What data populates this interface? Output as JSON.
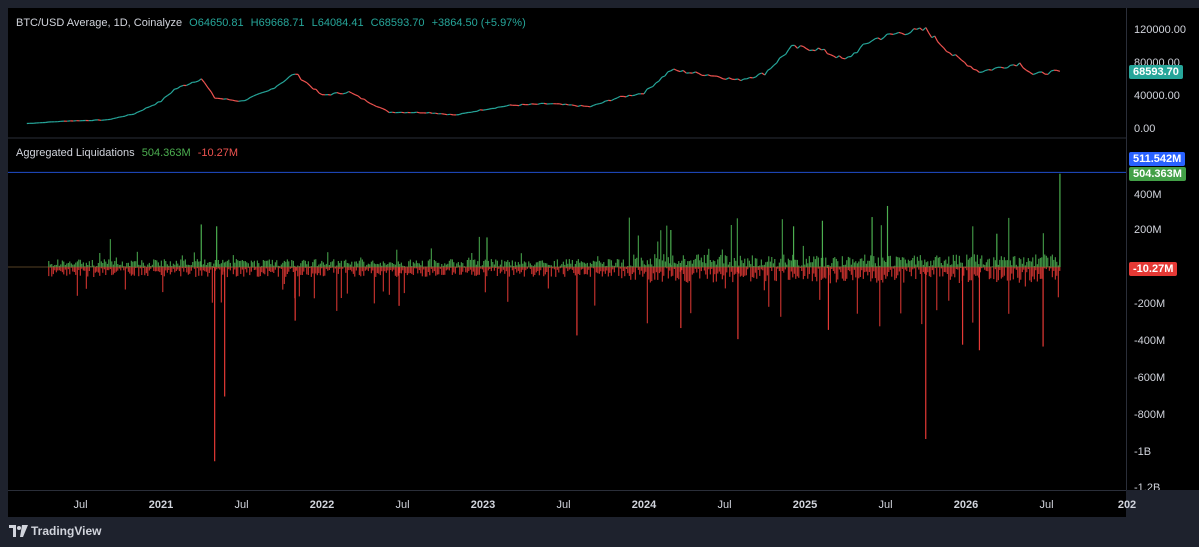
{
  "chart_data": [
    {
      "type": "candlestick-line",
      "title": "BTC/USD Average, 1D, Coinalyze",
      "ohlc": {
        "open_label": "O",
        "open": "64650.81",
        "high_label": "H",
        "high": "69668.71",
        "low_label": "L",
        "low": "64084.41",
        "close_label": "C",
        "close": "68593.70",
        "change": "+3864.50 (+5.97%)"
      },
      "y_ticks": [
        "120000.00",
        "80000.00",
        "40000.00",
        "0.00"
      ],
      "ylim": [
        0,
        130000
      ],
      "last_price_label": "68593.70",
      "x_start": "2020-03",
      "x_end": "2026-08",
      "series": [
        {
          "x": "2020-03",
          "y": 6500
        },
        {
          "x": "2020-06",
          "y": 9500
        },
        {
          "x": "2020-09",
          "y": 10800
        },
        {
          "x": "2020-11",
          "y": 18000
        },
        {
          "x": "2021-01",
          "y": 33000
        },
        {
          "x": "2021-02",
          "y": 47000
        },
        {
          "x": "2021-04",
          "y": 60000
        },
        {
          "x": "2021-05",
          "y": 37000
        },
        {
          "x": "2021-07",
          "y": 33000
        },
        {
          "x": "2021-09",
          "y": 45000
        },
        {
          "x": "2021-11",
          "y": 66000
        },
        {
          "x": "2022-01",
          "y": 40000
        },
        {
          "x": "2022-03",
          "y": 44000
        },
        {
          "x": "2022-06",
          "y": 20000
        },
        {
          "x": "2022-09",
          "y": 19500
        },
        {
          "x": "2022-11",
          "y": 16500
        },
        {
          "x": "2023-01",
          "y": 23000
        },
        {
          "x": "2023-03",
          "y": 28000
        },
        {
          "x": "2023-06",
          "y": 30000
        },
        {
          "x": "2023-09",
          "y": 26500
        },
        {
          "x": "2023-11",
          "y": 37000
        },
        {
          "x": "2024-01",
          "y": 43000
        },
        {
          "x": "2024-03",
          "y": 70000
        },
        {
          "x": "2024-06",
          "y": 64000
        },
        {
          "x": "2024-08",
          "y": 58000
        },
        {
          "x": "2024-10",
          "y": 66000
        },
        {
          "x": "2024-12",
          "y": 97000
        },
        {
          "x": "2025-02",
          "y": 95000
        },
        {
          "x": "2025-04",
          "y": 82000
        },
        {
          "x": "2025-06",
          "y": 106000
        },
        {
          "x": "2025-08",
          "y": 114000
        },
        {
          "x": "2025-10",
          "y": 118000
        },
        {
          "x": "2025-12",
          "y": 88000
        },
        {
          "x": "2026-02",
          "y": 68000
        },
        {
          "x": "2026-05",
          "y": 78000
        },
        {
          "x": "2026-06",
          "y": 65000
        },
        {
          "x": "2026-08",
          "y": 68593.7
        }
      ]
    },
    {
      "type": "bar",
      "title": "Aggregated Liquidations",
      "long_value": "504.363M",
      "short_value": "-10.27M",
      "y_ticks": [
        "400M",
        "200M",
        "-200M",
        "-400M",
        "-600M",
        "-800M",
        "-1B",
        "-1.2B"
      ],
      "ylim": [
        -1250,
        540
      ],
      "units": "M",
      "badges": {
        "max_label": "511.542M",
        "long_label": "504.363M",
        "short_label": "-10.27M"
      },
      "spikes_long": [
        {
          "x": "2021-04",
          "y": 230
        },
        {
          "x": "2021-05",
          "y": 220
        },
        {
          "x": "2023-01",
          "y": 160
        },
        {
          "x": "2024-03",
          "y": 200
        },
        {
          "x": "2024-12",
          "y": 220
        },
        {
          "x": "2025-02",
          "y": 250
        },
        {
          "x": "2025-06",
          "y": 270
        },
        {
          "x": "2025-07",
          "y": 330
        },
        {
          "x": "2026-03",
          "y": 180
        },
        {
          "x": "2026-08",
          "y": 504.363
        }
      ],
      "spikes_short": [
        {
          "x": "2021-05",
          "y": -1050
        },
        {
          "x": "2021-05",
          "y": -700
        },
        {
          "x": "2021-11",
          "y": -290
        },
        {
          "x": "2022-06",
          "y": -210
        },
        {
          "x": "2023-08",
          "y": -370
        },
        {
          "x": "2024-03",
          "y": -330
        },
        {
          "x": "2024-08",
          "y": -390
        },
        {
          "x": "2025-02",
          "y": -340
        },
        {
          "x": "2025-10",
          "y": -930
        },
        {
          "x": "2025-12",
          "y": -420
        },
        {
          "x": "2026-02",
          "y": -450
        },
        {
          "x": "2026-06",
          "y": -430
        }
      ]
    }
  ],
  "x_axis": {
    "ticks": [
      {
        "label": "Jul",
        "x": "2020-07",
        "year": false
      },
      {
        "label": "2021",
        "x": "2021-01",
        "year": true
      },
      {
        "label": "Jul",
        "x": "2021-07",
        "year": false
      },
      {
        "label": "2022",
        "x": "2022-01",
        "year": true
      },
      {
        "label": "Jul",
        "x": "2022-07",
        "year": false
      },
      {
        "label": "2023",
        "x": "2023-01",
        "year": true
      },
      {
        "label": "Jul",
        "x": "2023-07",
        "year": false
      },
      {
        "label": "2024",
        "x": "2024-01",
        "year": true
      },
      {
        "label": "Jul",
        "x": "2024-07",
        "year": false
      },
      {
        "label": "2025",
        "x": "2025-01",
        "year": true
      },
      {
        "label": "Jul",
        "x": "2025-07",
        "year": false
      },
      {
        "label": "2026",
        "x": "2026-01",
        "year": true
      },
      {
        "label": "Jul",
        "x": "2026-07",
        "year": false
      },
      {
        "label": "202",
        "x": "2027-01",
        "year": true
      }
    ]
  },
  "colors": {
    "up": "#26a69a",
    "down": "#ef5350",
    "long_bar": "#4caf50",
    "short_bar": "#e53935",
    "badge_max": "#2962ff",
    "badge_long": "#43a047",
    "badge_short": "#e53935",
    "badge_price": "#26a69a"
  },
  "footer": {
    "brand": "TradingView"
  }
}
